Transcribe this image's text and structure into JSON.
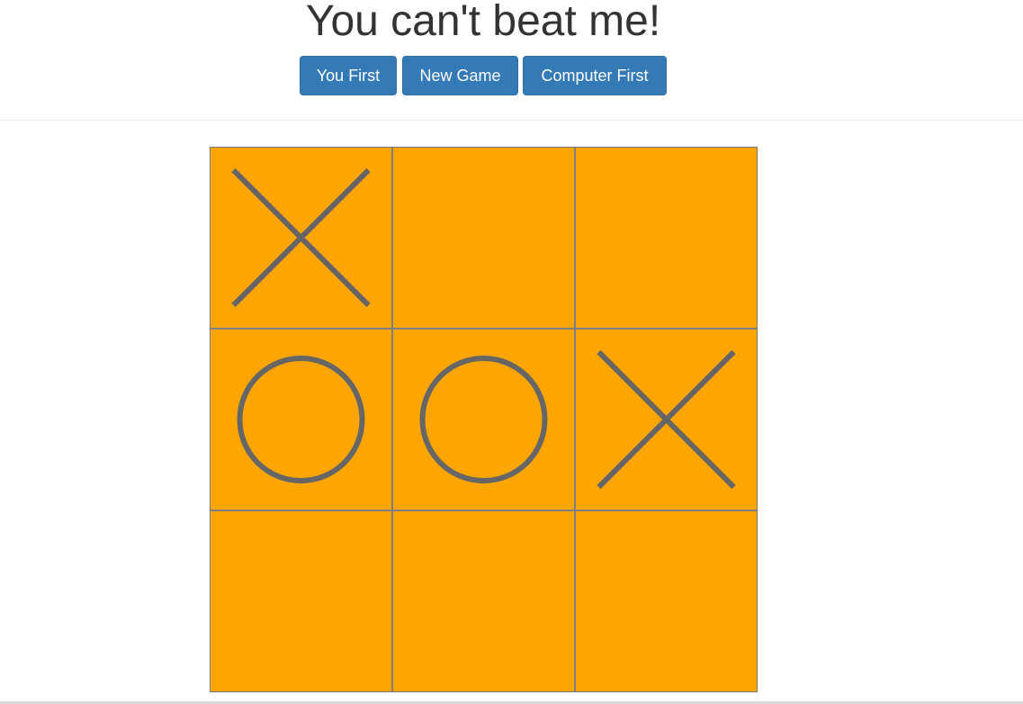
{
  "header": {
    "title": "You can't beat me!"
  },
  "toolbar": {
    "buttons": [
      {
        "id": "you-first",
        "label": "You First"
      },
      {
        "id": "new-game",
        "label": "New Game"
      },
      {
        "id": "computer-first",
        "label": "Computer First"
      }
    ]
  },
  "board": {
    "cells": [
      "X",
      "",
      "",
      "O",
      "O",
      "X",
      "",
      "",
      ""
    ]
  },
  "colors": {
    "accent": "#337ab7",
    "board": "#ffa500",
    "mark": "#666666",
    "grid": "#808080",
    "title": "#333333"
  }
}
